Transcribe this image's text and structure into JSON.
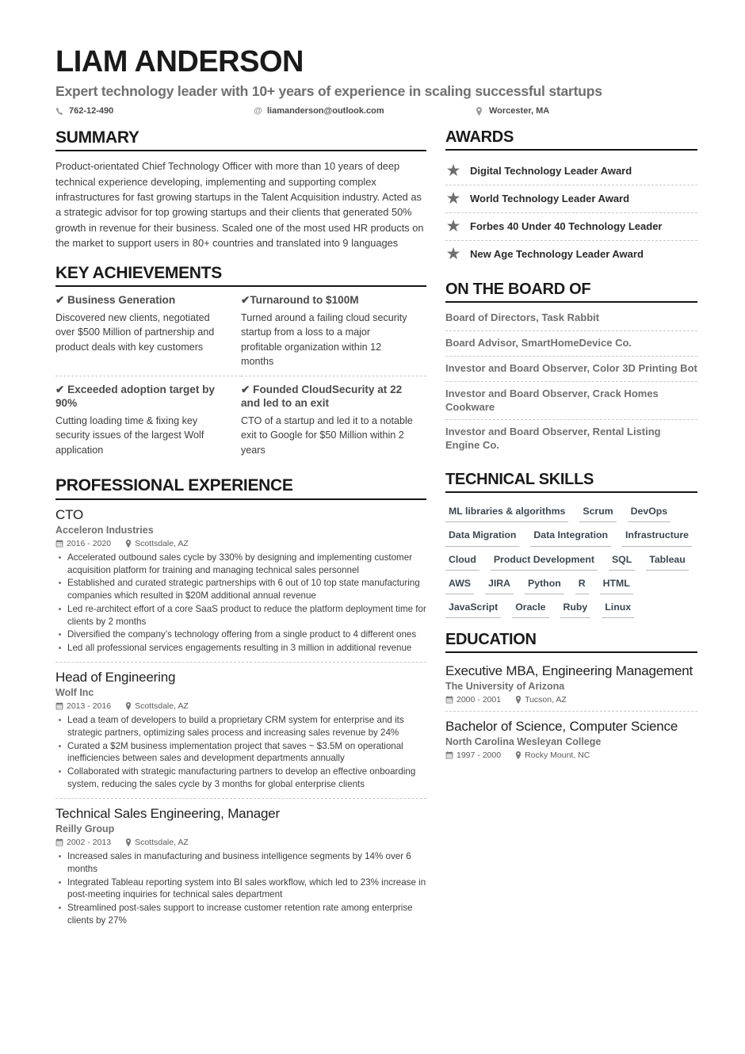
{
  "header": {
    "full_name": "LIAM ANDERSON",
    "headline": "Expert technology leader with 10+ years of experience in scaling successful startups",
    "phone": "762-12-490",
    "email": "liamanderson@outlook.com",
    "location": "Worcester, MA",
    "phone_icon": "phone-icon",
    "email_icon": "at-sign-icon",
    "location_icon": "map-pin-icon"
  },
  "summary": {
    "title": "SUMMARY",
    "text": "Product-orientated Chief Technology Officer with more than 10 years of deep technical experience developing, implementing and supporting complex infrastructures for fast growing startups in the Talent Acquisition industry. Acted as a strategic advisor for top growing startups and their clients that generated 50% growth in revenue for their business. Scaled one of the most used HR products on the market to support users in 80+ countries and translated into 9 languages"
  },
  "key_achievements": {
    "title": "KEY ACHIEVEMENTS",
    "items": [
      {
        "title": "✔ Business Generation",
        "desc": "Discovered new clients, negotiated over $500 Million of partnership and product deals with key customers"
      },
      {
        "title": "✔Turnaround to $100M",
        "desc": "Turned around a failing cloud security startup from a loss to a major profitable organization within 12 months"
      },
      {
        "title": "✔ Exceeded adoption target by 90%",
        "desc": "Cutting loading time & fixing key security issues of the largest Wolf application"
      },
      {
        "title": "✔ Founded CloudSecurity at 22 and led to an exit",
        "desc": "CTO of a startup and led it to a notable exit to Google for $50 Million within 2 years"
      }
    ]
  },
  "experience": {
    "title": "PROFESSIONAL EXPERIENCE",
    "jobs": [
      {
        "role": "CTO",
        "company": "Acceleron Industries",
        "dates": "2016 - 2020",
        "location": "Scottsdale, AZ",
        "bullets": [
          "Accelerated outbound sales cycle by 330% by designing and implementing customer acquisition platform for training and managing technical sales personnel",
          "Established and curated strategic partnerships with 6 out of 10 top state manufacturing companies which resulted in $20M additional annual revenue",
          "Led re-architect effort of a core SaaS product to reduce the platform deployment time for clients by 2 months",
          "Diversified the company’s technology offering from a single product to 4 different ones",
          "Led all professional services engagements resulting in 3 million in additional revenue"
        ]
      },
      {
        "role": "Head of Engineering",
        "company": "Wolf Inc",
        "dates": "2013 - 2016",
        "location": "Scottsdale, AZ",
        "bullets": [
          "Lead a team of developers to build a proprietary CRM system for enterprise and its strategic partners, optimizing sales process and increasing sales revenue by 24%",
          "Curated a $2M business implementation project that saves ~ $3.5M on operational inefficiencies between sales and development departments annually",
          "Collaborated with strategic manufacturing partners to develop an effective onboarding system, reducing the sales cycle by 3 months for global enterprise clients"
        ]
      },
      {
        "role": "Technical Sales Engineering, Manager",
        "company": "Reilly Group",
        "dates": "2002 - 2013",
        "location": "Scottsdale, AZ",
        "bullets": [
          "Increased sales in manufacturing and business intelligence segments by 14% over 6 months",
          "Integrated Tableau reporting system into BI sales workflow, which led to 23% increase in post-meeting inquiries for technical sales department",
          "Streamlined post-sales support to increase customer retention rate among enterprise clients by 27%"
        ]
      }
    ]
  },
  "awards": {
    "title": "AWARDS",
    "icon": "star-icon",
    "items": [
      "Digital Technology Leader Award",
      "World Technology Leader Award",
      "Forbes 40 Under 40 Technology Leader",
      "New Age Technology Leader Award"
    ]
  },
  "board": {
    "title": "ON THE BOARD OF",
    "items": [
      "Board of Directors, Task Rabbit",
      "Board Advisor, SmartHomeDevice Co.",
      "Investor and Board Observer, Color 3D Printing Bot",
      "Investor and Board Observer, Crack Homes Cookware",
      "Investor and Board Observer, Rental Listing Engine Co."
    ]
  },
  "skills": {
    "title": "TECHNICAL SKILLS",
    "items": [
      "ML libraries & algorithms",
      "Scrum",
      "DevOps",
      "Data Migration",
      "Data Integration",
      "Infrastructure",
      "Cloud",
      "Product Development",
      "SQL",
      "Tableau",
      "AWS",
      "JIRA",
      "Python",
      "R",
      "HTML",
      "JavaScript",
      "Oracle",
      "Ruby",
      "Linux"
    ]
  },
  "education": {
    "title": "EDUCATION",
    "items": [
      {
        "degree": "Executive MBA, Engineering Management",
        "school": "The University of Arizona",
        "dates": "2000 - 2001",
        "location": "Tucson, AZ"
      },
      {
        "degree": "Bachelor of Science, Computer Science",
        "school": "North Carolina Wesleyan College",
        "dates": "1997 - 2000",
        "location": "Rocky Mount, NC"
      }
    ]
  },
  "colors": {
    "text_dark": "#1a1a1a",
    "text_body": "#3d3d3d",
    "text_muted": "#6f6f6f",
    "rule": "#161616",
    "dashed": "#c9c9c9",
    "star": "#6e6e6e",
    "skill_text": "#3a4752"
  }
}
